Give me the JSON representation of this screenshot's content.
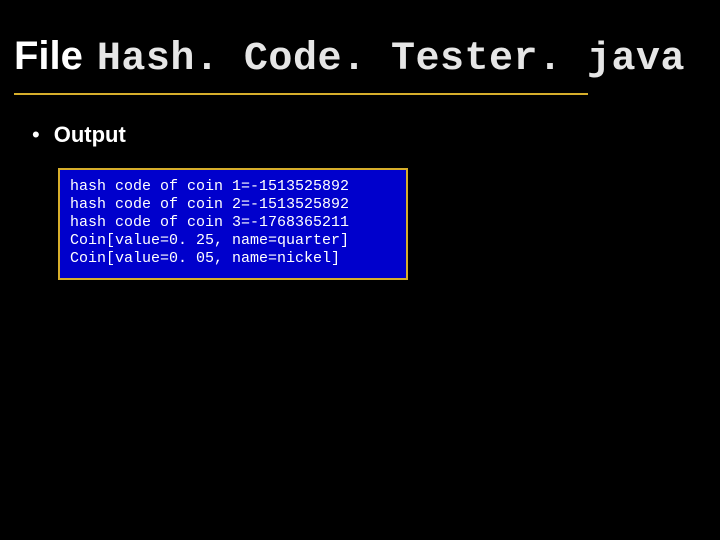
{
  "title": {
    "prefix": "File",
    "filename": "Hash. Code. Tester. java"
  },
  "bullet": {
    "marker": "•",
    "text": "Output"
  },
  "code": {
    "lines": [
      "hash code of coin 1=-1513525892",
      "hash code of coin 2=-1513525892",
      "hash code of coin 3=-1768365211",
      "Coin[value=0. 25, name=quarter]",
      "Coin[value=0. 05, name=nickel]"
    ]
  },
  "colors": {
    "accent": "#d6ae2b",
    "code_bg": "#0000CC",
    "bg": "#000000"
  }
}
